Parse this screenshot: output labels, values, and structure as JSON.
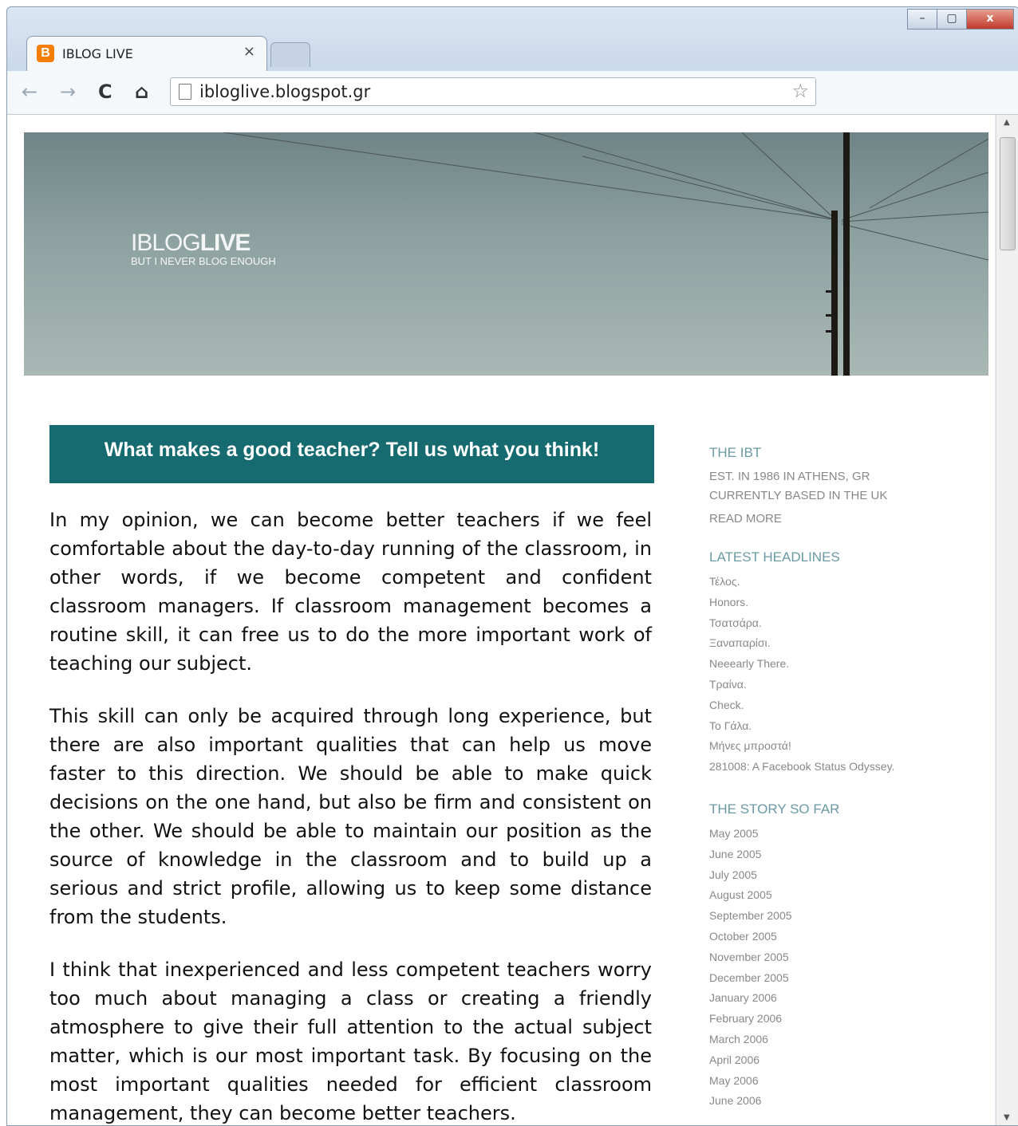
{
  "browser": {
    "tab_title": "IBLOG LIVE",
    "tab_favicon": "B",
    "tab_close": "×",
    "url": "ibloglive.blogspot.gr",
    "nav_back": "←",
    "nav_forward": "→",
    "nav_reload": "C",
    "nav_home": "⌂",
    "star": "☆",
    "win_min": "–",
    "win_max": "▢",
    "win_close": "x"
  },
  "banner": {
    "logo_light": "IBLOG",
    "logo_bold": "LIVE",
    "tagline": "BUT I NEVER BLOG ENOUGH"
  },
  "post": {
    "title": "What makes a good teacher? Tell us what you think!",
    "paragraphs": [
      "In my opinion, we can become better teachers if we feel comfortable about the day-to-day running of the classroom, in other words, if we become competent and confident classroom managers. If classroom management becomes a routine skill, it can free us to do the more important work of teaching our subject.",
      "This skill can only be acquired through long experience, but there are also important qualities that can help us move faster to this direction. We should be able to make quick decisions on the one hand, but also be firm and consistent on the other. We should be able to maintain our position as the source of knowledge in the classroom and to build up a serious and strict profile, allowing us to keep some distance from the students.",
      "I think that inexperienced and less competent teachers worry too much about managing a class or creating a friendly atmosphere to give their full attention to the actual subject matter, which is our most important task. By focusing on the most important qualities needed for efficient classroom management, they can become better teachers."
    ]
  },
  "sidebar": {
    "about": {
      "heading": "THE IBT",
      "line1": "EST. IN 1986 IN ATHENS, GR",
      "line2": "CURRENTLY BASED IN THE UK",
      "read_more": "READ MORE"
    },
    "headlines": {
      "heading": "LATEST HEADLINES",
      "items": [
        "Τέλος.",
        "Honors.",
        "Τσατσάρα.",
        "Ξαναπαρίσι.",
        "Neeearly There.",
        "Τραίνα.",
        "Check.",
        "Το Γάλα.",
        "Μήνες μπροστά!",
        "281008: A Facebook Status Odyssey."
      ]
    },
    "archive": {
      "heading": "THE STORY SO FAR",
      "items": [
        "May 2005",
        "June 2005",
        "July 2005",
        "August 2005",
        "September 2005",
        "October 2005",
        "November 2005",
        "December 2005",
        "January 2006",
        "February 2006",
        "March 2006",
        "April 2006",
        "May 2006",
        "June 2006"
      ]
    }
  }
}
